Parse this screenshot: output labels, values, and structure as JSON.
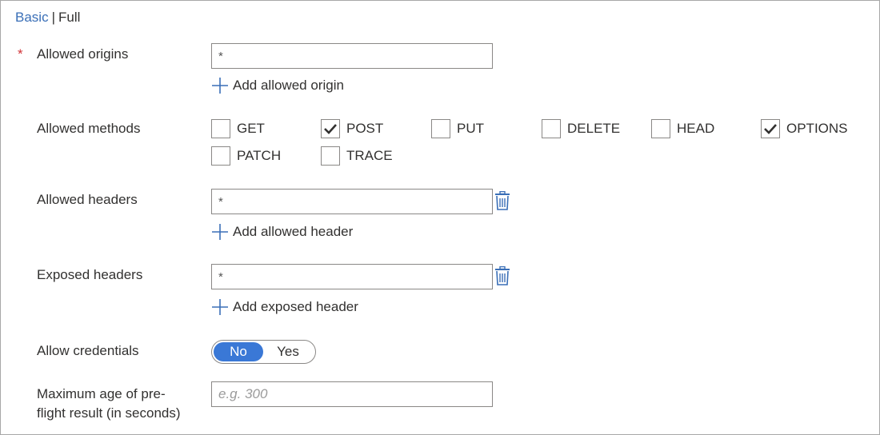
{
  "mode_switch": {
    "basic": "Basic",
    "separator": "|",
    "full": "Full"
  },
  "required_marker": "*",
  "allowed_origins": {
    "label": "Allowed origins",
    "value": "*",
    "add_label": "Add allowed origin"
  },
  "allowed_methods": {
    "label": "Allowed methods",
    "options": [
      {
        "name": "GET",
        "checked": false
      },
      {
        "name": "POST",
        "checked": true
      },
      {
        "name": "PUT",
        "checked": false
      },
      {
        "name": "DELETE",
        "checked": false
      },
      {
        "name": "HEAD",
        "checked": false
      },
      {
        "name": "OPTIONS",
        "checked": true
      },
      {
        "name": "PATCH",
        "checked": false
      },
      {
        "name": "TRACE",
        "checked": false
      }
    ]
  },
  "allowed_headers": {
    "label": "Allowed headers",
    "value": "*",
    "add_label": "Add allowed header"
  },
  "exposed_headers": {
    "label": "Exposed headers",
    "value": "*",
    "add_label": "Add exposed header"
  },
  "allow_credentials": {
    "label": "Allow credentials",
    "no": "No",
    "yes": "Yes",
    "selected": "No"
  },
  "max_age": {
    "label_line1": "Maximum age of pre-",
    "label_line2": "flight result (in seconds)",
    "placeholder": "e.g. 300"
  },
  "colors": {
    "link": "#3a6fb7",
    "toggle_on": "#3a78d6",
    "required": "#d13438"
  }
}
